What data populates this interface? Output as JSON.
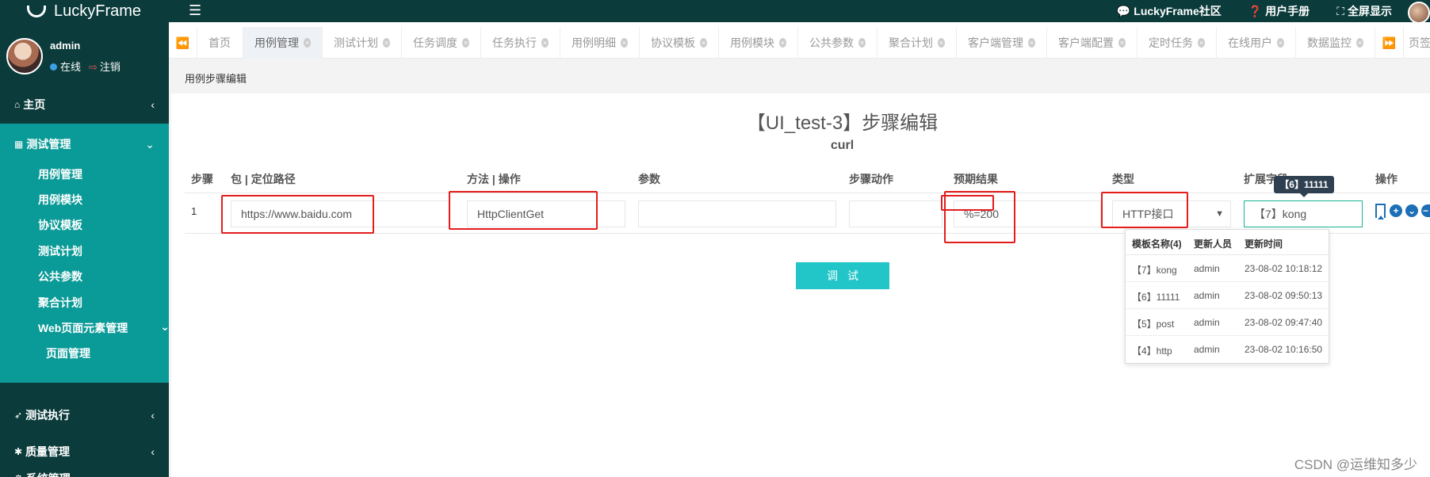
{
  "app": {
    "title": "LuckyFrame"
  },
  "topnav": {
    "community": "LuckyFrame社区",
    "manual": "用户手册",
    "fullscreen": "全屏显示"
  },
  "user": {
    "name": "admin",
    "status": "在线",
    "logout": "注销"
  },
  "sidebar": {
    "home": "主页",
    "test_mgmt": "测试管理",
    "sub_items": [
      "用例管理",
      "用例模块",
      "协议模板",
      "测试计划",
      "公共参数",
      "聚合计划",
      "Web页面元素管理"
    ],
    "sub_sub_item": "页面管理",
    "test_exec": "测试执行",
    "quality_mgmt": "质量管理",
    "system_mgmt": "系统管理"
  },
  "tabs": [
    "首页",
    "用例管理",
    "测试计划",
    "任务调度",
    "任务执行",
    "用例明细",
    "协议模板",
    "用例模块",
    "公共参数",
    "聚合计划",
    "客户端管理",
    "客户端配置",
    "定时任务",
    "在线用户",
    "数据监控"
  ],
  "tabs_overflow": "页签",
  "breadcrumb": "用例步骤编辑",
  "page": {
    "title": "【UI_test-3】步骤编辑",
    "subtitle": "curl"
  },
  "table": {
    "headers": [
      "步骤",
      "包 | 定位路径",
      "方法 | 操作",
      "参数",
      "步骤动作",
      "预期结果",
      "类型",
      "扩展字段",
      "操作"
    ],
    "row": {
      "step": "1",
      "path": "https://www.baidu.com",
      "method": "HttpClientGet",
      "param": "",
      "action": "",
      "expected": "%=200",
      "type": "HTTP接口",
      "ext": "【7】kong"
    }
  },
  "tooltip": "【6】11111",
  "dropdown": {
    "headers": [
      "模板名称(4)",
      "更新人员",
      "更新时间"
    ],
    "rows": [
      [
        "【7】kong",
        "admin",
        "23-08-02 10:18:12"
      ],
      [
        "【6】11111",
        "admin",
        "23-08-02 09:50:13"
      ],
      [
        "【5】post",
        "admin",
        "23-08-02 09:47:40"
      ],
      [
        "【4】http",
        "admin",
        "23-08-02 10:16:50"
      ]
    ]
  },
  "debug_button": "调试",
  "watermark": "CSDN @运维知多少",
  "colors": {
    "sidebar": "#0b3b3b",
    "menu_active": "#0a9a97",
    "button": "#23c6c8",
    "highlight": "#e41c1c"
  }
}
